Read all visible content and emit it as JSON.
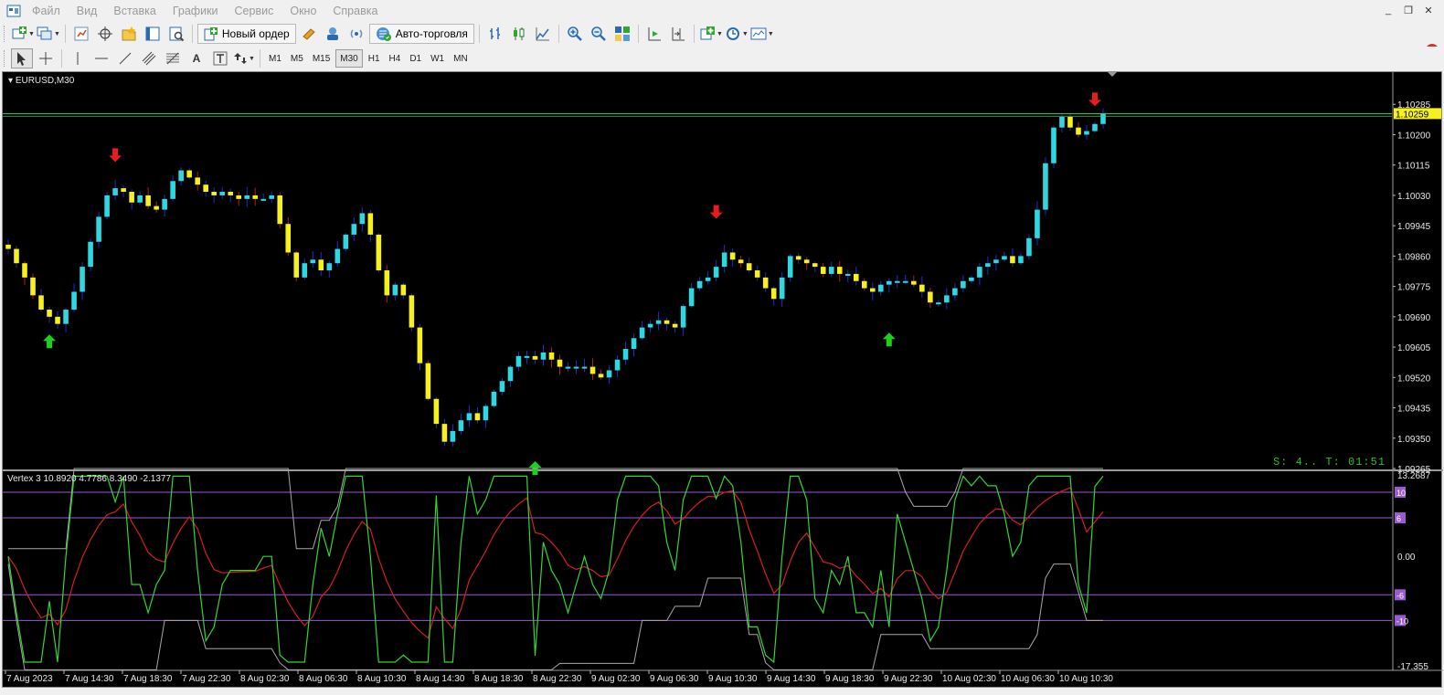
{
  "menu": {
    "items": [
      "Файл",
      "Вид",
      "Вставка",
      "Графики",
      "Сервис",
      "Окно",
      "Справка"
    ]
  },
  "toolbar": {
    "new_order_label": "Новый ордер",
    "autotrade_label": "Авто-торговля",
    "notification_count": "1"
  },
  "timeframes": [
    "M1",
    "M5",
    "M15",
    "M30",
    "H1",
    "H4",
    "D1",
    "W1",
    "MN"
  ],
  "active_timeframe": "M30",
  "chart": {
    "symbol_label": "EURUSD,M30",
    "current_price": "1.10259",
    "timer_text": "S: 4.. T: 01:51",
    "price_ticks": [
      "1.10285",
      "1.10200",
      "1.10115",
      "1.10030",
      "1.09945",
      "1.09860",
      "1.09775",
      "1.09690",
      "1.09605",
      "1.09520",
      "1.09435",
      "1.09350",
      "1.09265"
    ],
    "time_ticks": [
      "7 Aug 2023",
      "7 Aug 14:30",
      "7 Aug 18:30",
      "7 Aug 22:30",
      "8 Aug 02:30",
      "8 Aug 06:30",
      "8 Aug 10:30",
      "8 Aug 14:30",
      "8 Aug 18:30",
      "8 Aug 22:30",
      "9 Aug 02:30",
      "9 Aug 06:30",
      "9 Aug 10:30",
      "9 Aug 14:30",
      "9 Aug 18:30",
      "9 Aug 22:30",
      "10 Aug 02:30",
      "10 Aug 06:30",
      "10 Aug 10:30"
    ]
  },
  "indicator": {
    "label": "Vertex 3 10.8920 4.7786 8.3490 -2.1377",
    "axis_ticks": [
      "13.2687",
      "0.00",
      "-17.355"
    ],
    "level_labels": [
      "10",
      "6",
      "-6",
      "-10"
    ]
  },
  "colors": {
    "bull": "#2fd8e0",
    "bear": "#f5f01e",
    "wick": "#1c2fd0",
    "wick_red": "#b02020",
    "arrow_up": "#19d219",
    "arrow_down": "#e81c1c",
    "price_line": "#44c870",
    "level_line": "#9b5ad0",
    "vertex_green": "#33d633",
    "vertex_red": "#d42020",
    "band": "#a8a8a8"
  },
  "chart_data": {
    "type": "candlestick",
    "symbol": "EURUSD",
    "timeframe": "M30",
    "ylim": [
      1.09265,
      1.1037
    ],
    "last_price": 1.10259,
    "close": [
      1.0988,
      1.0984,
      1.098,
      1.0975,
      1.0971,
      1.0969,
      1.0967,
      1.0971,
      1.0976,
      1.0983,
      1.099,
      1.0997,
      1.1003,
      1.1005,
      1.1004,
      1.1001,
      1.1003,
      1.1,
      1.0999,
      1.1002,
      1.1007,
      1.101,
      1.1008,
      1.1006,
      1.1004,
      1.1003,
      1.1004,
      1.1003,
      1.1002,
      1.1003,
      1.1002,
      1.1002,
      1.1003,
      1.0995,
      1.0987,
      1.098,
      1.0984,
      1.0985,
      1.0982,
      1.0984,
      1.0988,
      1.0992,
      1.0995,
      1.0998,
      1.0992,
      1.0982,
      1.0975,
      1.0978,
      1.0975,
      1.0966,
      1.0956,
      1.0946,
      1.0939,
      1.0934,
      1.0937,
      1.094,
      1.0942,
      1.094,
      1.0944,
      1.0948,
      1.0951,
      1.0955,
      1.0958,
      1.0958,
      1.0957,
      1.0959,
      1.0957,
      1.0955,
      1.0955,
      1.0955,
      1.0955,
      1.0953,
      1.0952,
      1.0954,
      1.0957,
      1.096,
      1.0963,
      1.0966,
      1.0967,
      1.0968,
      1.0967,
      1.0966,
      1.0972,
      1.0977,
      1.0979,
      1.098,
      1.0983,
      1.0987,
      1.0985,
      1.0984,
      1.0982,
      1.098,
      1.0977,
      1.0974,
      1.098,
      1.0986,
      1.0985,
      1.0984,
      1.0983,
      1.0981,
      1.0983,
      1.0981,
      1.0981,
      1.0979,
      1.0977,
      1.0976,
      1.0978,
      1.0979,
      1.0979,
      1.0979,
      1.0978,
      1.0976,
      1.0973,
      1.0973,
      1.0975,
      1.0977,
      1.0979,
      1.098,
      1.0983,
      1.0984,
      1.0985,
      1.0986,
      1.0984,
      1.0986,
      1.0991,
      1.0999,
      1.1012,
      1.1022,
      1.1025,
      1.1022,
      1.102,
      1.1021,
      1.1023,
      1.1026
    ],
    "signals": [
      {
        "type": "buy",
        "time": "7 Aug 2023"
      },
      {
        "type": "sell",
        "time": "7 Aug 14:30"
      },
      {
        "type": "buy",
        "time": "8 Aug 14:30"
      },
      {
        "type": "sell",
        "time": "9 Aug 14:30"
      },
      {
        "type": "buy",
        "time": "10 Aug 02:30"
      },
      {
        "type": "sell",
        "time": "10 Aug 10:30"
      }
    ],
    "indicator": {
      "name": "Vertex 3",
      "values": [
        10.892,
        4.7786,
        8.349,
        -2.1377
      ],
      "ylim": [
        -17.355,
        13.2687
      ],
      "levels": [
        10,
        6,
        -6,
        -10
      ]
    }
  }
}
